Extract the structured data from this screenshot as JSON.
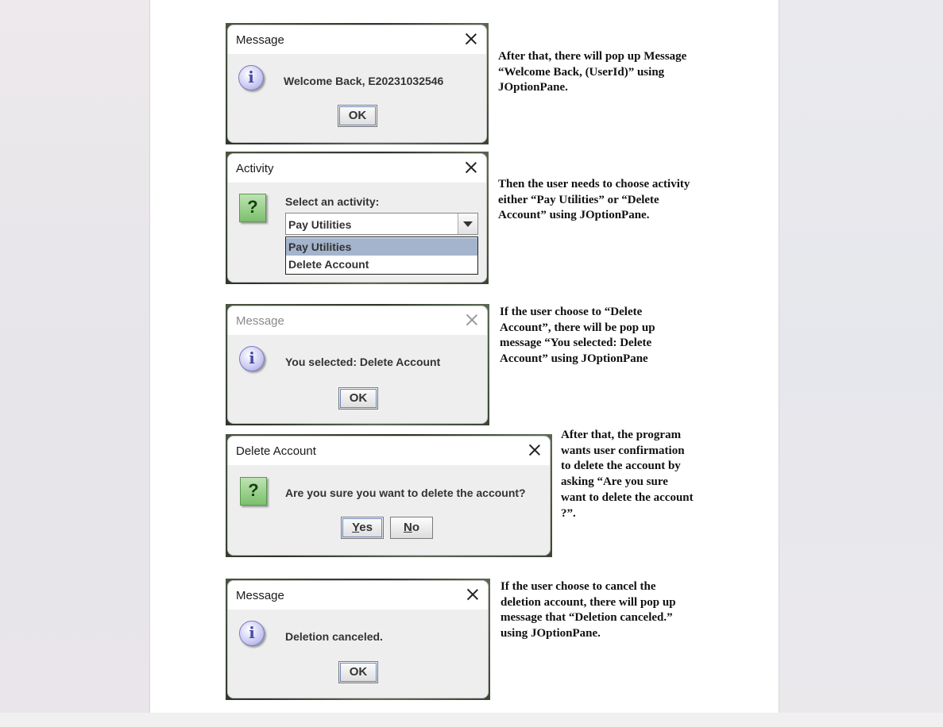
{
  "dialogs": {
    "welcome": {
      "title": "Message",
      "message": "Welcome Back, E20231032546",
      "ok": "OK"
    },
    "activity": {
      "title": "Activity",
      "prompt": "Select an activity:",
      "selected": "Pay Utilities",
      "options": [
        "Pay Utilities",
        "Delete Account"
      ]
    },
    "selected": {
      "title": "Message",
      "message": "You selected: Delete Account",
      "ok": "OK"
    },
    "confirm": {
      "title": "Delete Account",
      "message": "Are you sure you want to delete the account?",
      "yes_mnemonic": "Y",
      "yes_rest": "es",
      "no_mnemonic": "N",
      "no_rest": "o"
    },
    "canceled": {
      "title": "Message",
      "message": "Deletion canceled.",
      "ok": "OK"
    }
  },
  "notes": {
    "n1": [
      "After that, there will pop up Message",
      "“Welcome Back, (UserId)” using",
      "JOptionPane."
    ],
    "n2": [
      "Then the user needs to choose activity",
      "either “Pay Utilities” or “Delete",
      "Account” using JOptionPane."
    ],
    "n3": [
      "If the user choose to “Delete",
      "Account”, there will be pop up",
      "message “You selected: Delete",
      "Account” using JOptionPane"
    ],
    "n4": [
      "After that, the program",
      "wants user confirmation",
      "to delete the account by",
      "asking “Are you sure",
      "want to delete the account",
      "?”."
    ],
    "n5": [
      "If the user choose to cancel the",
      "deletion account, there will pop up",
      "message that “Deletion canceled.”",
      "using JOptionPane."
    ]
  },
  "icons": {
    "info": "information-icon",
    "question": "question-icon",
    "close": "close-icon",
    "dropdown": "chevron-down-icon"
  }
}
